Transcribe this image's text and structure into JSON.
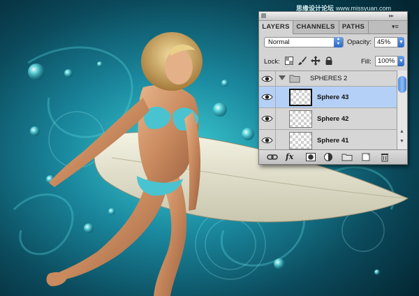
{
  "watermark": {
    "site_cn": "思缘设计论坛",
    "site_url": "www.missyuan.com"
  },
  "layers_panel": {
    "tabs": [
      {
        "label": "LAYERS",
        "active": true
      },
      {
        "label": "CHANNELS",
        "active": false
      },
      {
        "label": "PATHS",
        "active": false
      }
    ],
    "panel_menu_icon": "panel-menu-icon",
    "blend_mode": "Normal",
    "opacity_label": "Opacity:",
    "opacity_value": "45%",
    "lock_label": "Lock:",
    "lock_icons": [
      "lock-transparent-icon",
      "lock-paint-icon",
      "lock-move-icon",
      "lock-all-icon"
    ],
    "fill_label": "Fill:",
    "fill_value": "100%",
    "group": {
      "name": "SPHERES 2",
      "expanded": true,
      "visible": true
    },
    "layers": [
      {
        "name": "Sphere 43",
        "selected": true,
        "visible": true
      },
      {
        "name": "Sphere 42",
        "selected": false,
        "visible": true
      },
      {
        "name": "Sphere 41",
        "selected": false,
        "visible": true
      }
    ],
    "footer_icons": [
      "link-layers-icon",
      "fx-icon",
      "layer-mask-icon",
      "adjustment-layer-icon",
      "new-group-icon",
      "new-layer-icon",
      "trash-icon"
    ],
    "footer_fx_label": "fx"
  },
  "colors": {
    "background_dark": "#05303d",
    "background_teal": "#2fb6c0",
    "panel_gray": "#d4d4d4",
    "selection_blue": "#b4d0f6",
    "accent_blue": "#2c66c4"
  }
}
